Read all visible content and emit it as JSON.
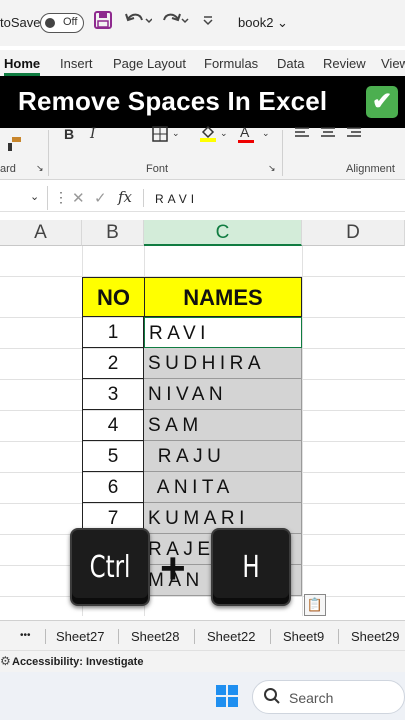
{
  "titlebar": {
    "autosave_label": "toSave",
    "toggle_label": "Off",
    "workbook_name": "book2 ⌄"
  },
  "ribbon_tabs": [
    "Home",
    "Insert",
    "Page Layout",
    "Formulas",
    "Data",
    "Review",
    "View"
  ],
  "banner": {
    "text": "Remove Spaces  In Excel",
    "accent": "#4caf50"
  },
  "ribbon": {
    "group_clipboard": "ard",
    "group_font": "Font",
    "group_alignment": "Alignment",
    "bold": "B",
    "italic": "I",
    "font_color_letter": "A"
  },
  "formula_bar": {
    "fx": "fx",
    "value": "RAVI"
  },
  "columns": [
    "A",
    "B",
    "C",
    "D"
  ],
  "table": {
    "header_no": "NO",
    "header_names": "NAMES",
    "header_fill": "#ffff00",
    "rows": [
      {
        "no": "1",
        "name": "RAVI"
      },
      {
        "no": "2",
        "name": "SUDHIRA"
      },
      {
        "no": "3",
        "name": "NIVAN"
      },
      {
        "no": "4",
        "name": "SAM"
      },
      {
        "no": "5",
        "name": " RAJU"
      },
      {
        "no": "6",
        "name": " ANITA"
      },
      {
        "no": "7",
        "name": "KUMARI"
      },
      {
        "no": "",
        "name": "RAJE"
      },
      {
        "no": "",
        "name": "MAN"
      }
    ]
  },
  "shortcut": {
    "key1": "Ctrl",
    "key2": "H",
    "plus": "+"
  },
  "sheets": [
    "•••",
    "Sheet27",
    "Sheet28",
    "Sheet22",
    "Sheet9",
    "Sheet29"
  ],
  "status": {
    "accessibility": "Accessibility: Investigate"
  },
  "taskbar": {
    "search_label": "Search"
  }
}
